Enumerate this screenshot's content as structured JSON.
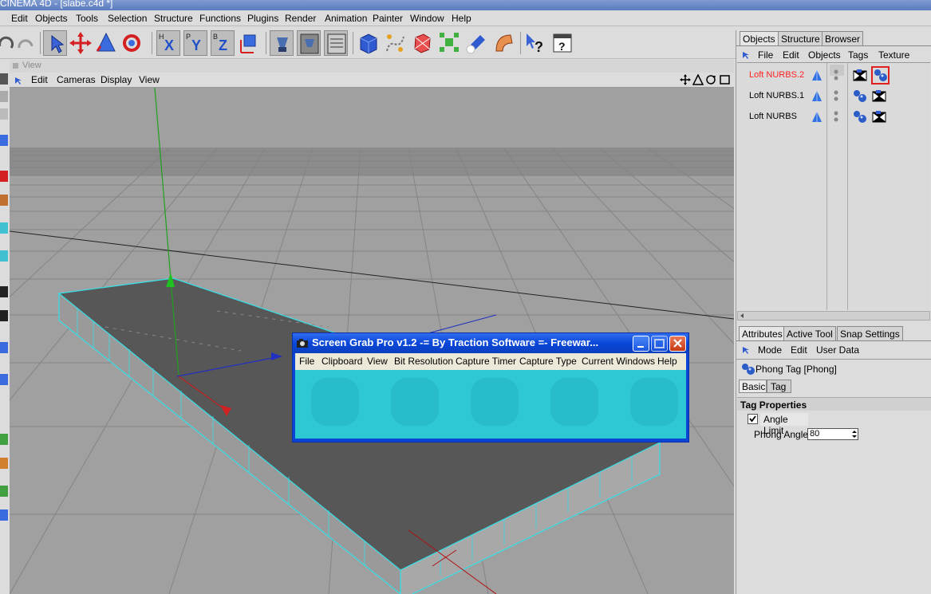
{
  "app": {
    "title": "CINEMA 4D - [slabe.c4d *]"
  },
  "menubar": [
    "Edit",
    "Objects",
    "Tools",
    "Selection",
    "Structure",
    "Functions",
    "Plugins",
    "Render",
    "Animation",
    "Painter",
    "Window",
    "Help"
  ],
  "toolbar": {
    "axis_labels": [
      "X",
      "Y",
      "Z"
    ],
    "axis_small": [
      "H",
      "P",
      "B"
    ]
  },
  "viewport": {
    "title": "View",
    "menu": [
      "Edit",
      "Cameras",
      "Display",
      "View"
    ]
  },
  "objects_manager": {
    "tabs": [
      "Objects",
      "Structure",
      "Browser"
    ],
    "menu": [
      "File",
      "Edit",
      "Objects",
      "Tags",
      "Texture"
    ],
    "items": [
      {
        "name": "Loft NURBS.2",
        "selected": true,
        "color": "#ff2020"
      },
      {
        "name": "Loft NURBS.1",
        "selected": false,
        "color": "#000000"
      },
      {
        "name": "Loft NURBS",
        "selected": false,
        "color": "#000000"
      }
    ]
  },
  "attributes_manager": {
    "tabs": [
      "Attributes",
      "Active Tool",
      "Snap Settings"
    ],
    "menu": [
      "Mode",
      "Edit",
      "User Data"
    ],
    "object_label": "Phong Tag [Phong]",
    "sub_tabs": [
      "Basic",
      "Tag"
    ],
    "section_title": "Tag Properties",
    "angle_limit": {
      "label": "Angle Limit",
      "checked": true
    },
    "phong_angle": {
      "label": "Phong Angle",
      "value": "80"
    }
  },
  "screen_grab": {
    "title": "Screen Grab Pro v1.2    -= By Traction Software =-    Freewar...",
    "menu": [
      "File",
      "Clipboard",
      "View",
      "Bit Resolution",
      "Capture Timer",
      "Capture Type",
      "Current Windows",
      "Help"
    ]
  },
  "colors": {
    "accent_cyan": "#2ec8d4",
    "selection_red": "#ff2020",
    "xp_blue": "#0a47d9"
  }
}
